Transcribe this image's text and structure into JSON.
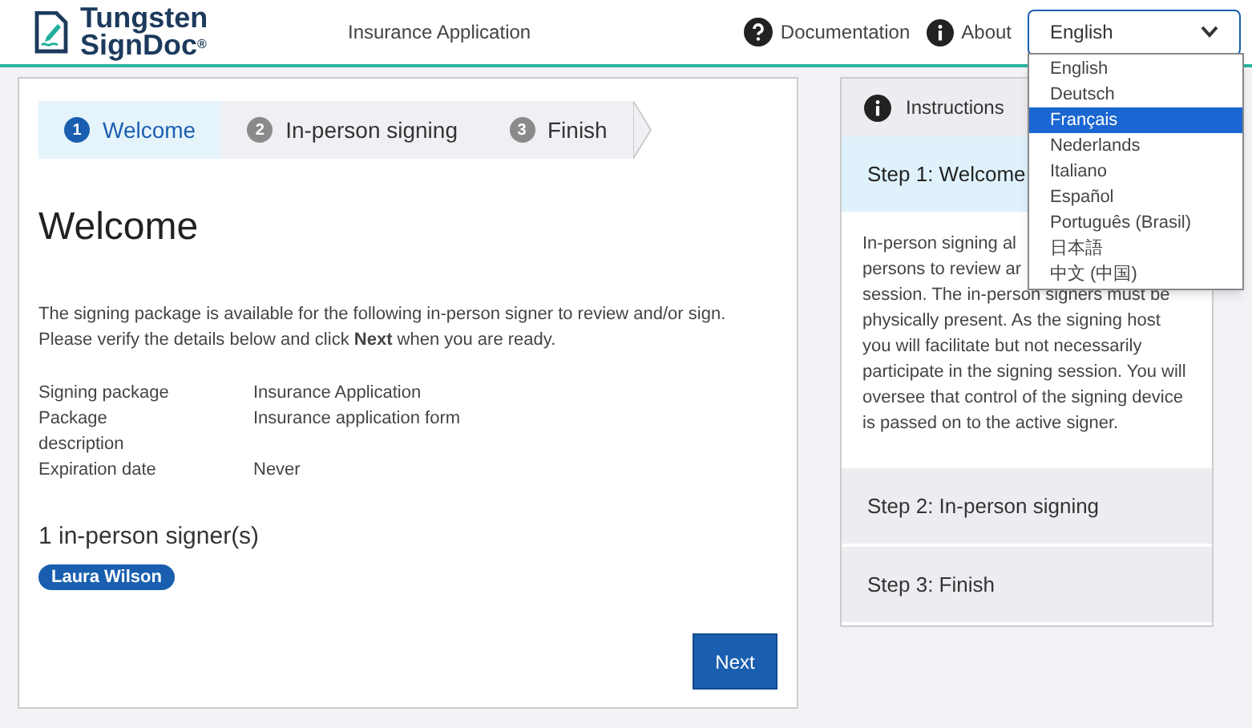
{
  "header": {
    "logo_line1": "Tungsten",
    "logo_line2": "SignDoc",
    "logo_mark": "®",
    "title": "Insurance Application",
    "links": [
      {
        "kind": "help",
        "label": "Documentation"
      },
      {
        "kind": "info",
        "label": "About"
      }
    ],
    "language": {
      "value": "English",
      "expanded": true,
      "options": [
        {
          "label": "English",
          "highlighted": false
        },
        {
          "label": "Deutsch",
          "highlighted": false
        },
        {
          "label": "Français",
          "highlighted": true
        },
        {
          "label": "Nederlands",
          "highlighted": false
        },
        {
          "label": "Italiano",
          "highlighted": false
        },
        {
          "label": "Español",
          "highlighted": false
        },
        {
          "label": "Português (Brasil)",
          "highlighted": false
        },
        {
          "label": "日本語",
          "highlighted": false
        },
        {
          "label": "中文 (中国)",
          "highlighted": false
        }
      ]
    }
  },
  "steps": [
    {
      "number": "1",
      "label": "Welcome",
      "selected": true
    },
    {
      "number": "2",
      "label": "In-person signing",
      "selected": false
    },
    {
      "number": "3",
      "label": "Finish",
      "selected": false
    }
  ],
  "heading": "Welcome",
  "intro": "The signing package is available for the following in-person signer to review and/or sign. Please verify the details below and click **Next** when you are ready.",
  "details": [
    {
      "label": "Signing package",
      "value": "Insurance Application"
    },
    {
      "label": "Package description",
      "value": "Insurance application form"
    },
    {
      "label": "Expiration date",
      "value": "Never"
    }
  ],
  "signers_heading": "1 in-person signer(s)",
  "signers": [
    "Laura Wilson"
  ],
  "next_button": "Next",
  "instructions": {
    "title": "Instructions",
    "sections": [
      {
        "title": "Step 1: Welcome",
        "expanded": true,
        "body_lines_cut": [
          "In-person signing al",
          "persons to review ar"
        ],
        "body": "session. The in-person signers must be physically present. As the signing host you will facilitate but not necessarily participate in the signing session. You will oversee that control of the signing device is passed on to the active signer."
      },
      {
        "title": "Step 2: In-person signing",
        "expanded": false
      },
      {
        "title": "Step 3: Finish",
        "expanded": false
      }
    ]
  }
}
